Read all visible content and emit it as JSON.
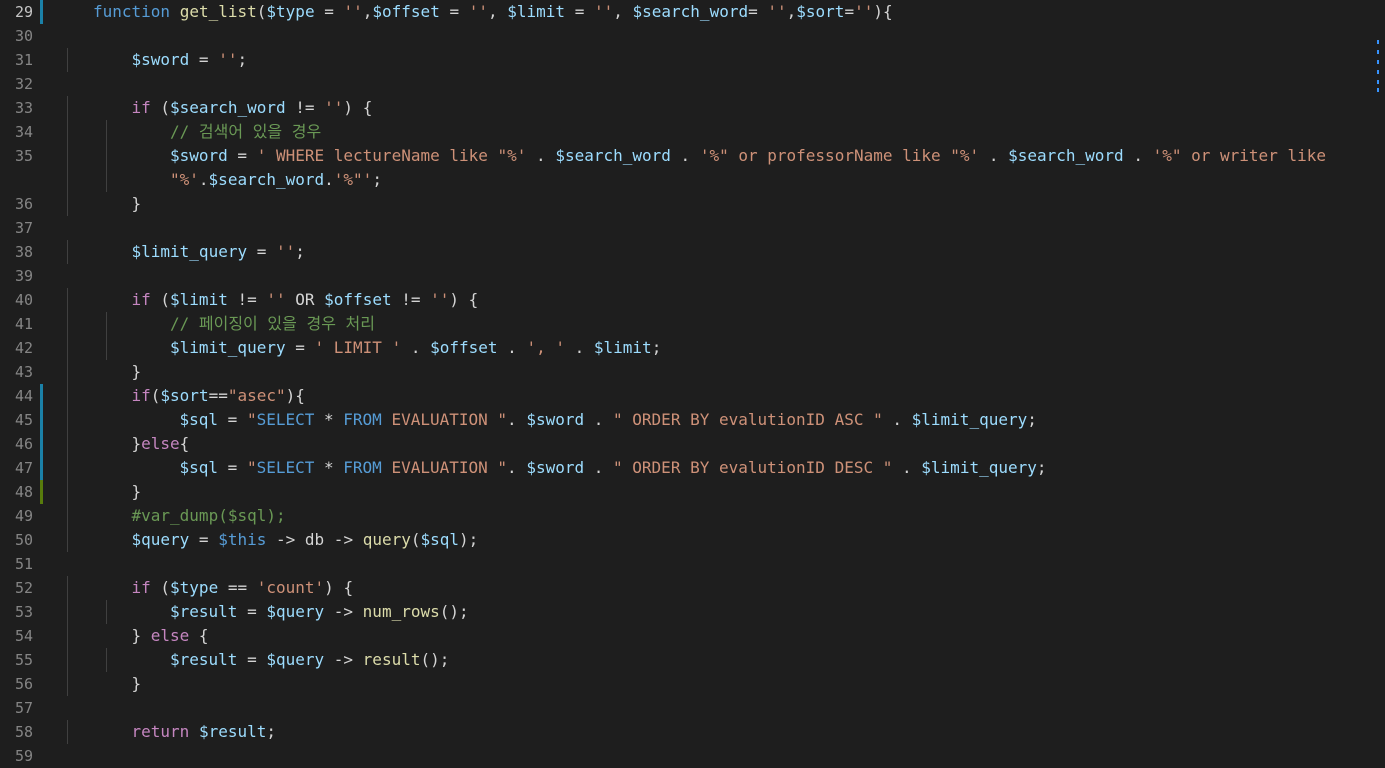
{
  "editor": {
    "lines": [
      {
        "n": "29",
        "mark": "modified",
        "current": true,
        "indent": 1,
        "tokens": [
          {
            "t": "function ",
            "c": "k"
          },
          {
            "t": "get_list",
            "c": "f"
          },
          {
            "t": "(",
            "c": "p"
          },
          {
            "t": "$type",
            "c": "v"
          },
          {
            "t": " = ",
            "c": "p"
          },
          {
            "t": "''",
            "c": "s"
          },
          {
            "t": ",",
            "c": "p"
          },
          {
            "t": "$offset",
            "c": "v"
          },
          {
            "t": " = ",
            "c": "p"
          },
          {
            "t": "''",
            "c": "s"
          },
          {
            "t": ", ",
            "c": "p"
          },
          {
            "t": "$limit",
            "c": "v"
          },
          {
            "t": " = ",
            "c": "p"
          },
          {
            "t": "''",
            "c": "s"
          },
          {
            "t": ", ",
            "c": "p"
          },
          {
            "t": "$search_word",
            "c": "v"
          },
          {
            "t": "= ",
            "c": "p"
          },
          {
            "t": "''",
            "c": "s"
          },
          {
            "t": ",",
            "c": "p"
          },
          {
            "t": "$sort",
            "c": "v"
          },
          {
            "t": "=",
            "c": "p"
          },
          {
            "t": "''",
            "c": "s"
          },
          {
            "t": "){",
            "c": "p"
          }
        ]
      },
      {
        "n": "30",
        "indent": 0,
        "tokens": []
      },
      {
        "n": "31",
        "indent": 2,
        "tokens": [
          {
            "t": "$sword",
            "c": "v"
          },
          {
            "t": " = ",
            "c": "p"
          },
          {
            "t": "''",
            "c": "s"
          },
          {
            "t": ";",
            "c": "p"
          }
        ]
      },
      {
        "n": "32",
        "indent": 0,
        "tokens": []
      },
      {
        "n": "33",
        "indent": 2,
        "tokens": [
          {
            "t": "if",
            "c": "c"
          },
          {
            "t": " (",
            "c": "p"
          },
          {
            "t": "$search_word",
            "c": "v"
          },
          {
            "t": " != ",
            "c": "p"
          },
          {
            "t": "''",
            "c": "s"
          },
          {
            "t": ") {",
            "c": "p"
          }
        ]
      },
      {
        "n": "34",
        "indent": 3,
        "tokens": [
          {
            "t": "// 검색어 있을 경우",
            "c": "cm"
          }
        ]
      },
      {
        "n": "35",
        "indent": 3,
        "tokens": [
          {
            "t": "$sword",
            "c": "v"
          },
          {
            "t": " = ",
            "c": "p"
          },
          {
            "t": "' WHERE lectureName like \"%'",
            "c": "s"
          },
          {
            "t": " . ",
            "c": "p"
          },
          {
            "t": "$search_word",
            "c": "v"
          },
          {
            "t": " . ",
            "c": "p"
          },
          {
            "t": "'%\" or professorName like \"%'",
            "c": "s"
          },
          {
            "t": " . ",
            "c": "p"
          },
          {
            "t": "$search_word",
            "c": "v"
          },
          {
            "t": " . ",
            "c": "p"
          },
          {
            "t": "'%\" or writer like",
            "c": "s"
          }
        ]
      },
      {
        "n": "",
        "indent": 3,
        "tokens": [
          {
            "t": "\"%'",
            "c": "s"
          },
          {
            "t": ".",
            "c": "p"
          },
          {
            "t": "$search_word",
            "c": "v"
          },
          {
            "t": ".",
            "c": "p"
          },
          {
            "t": "'%\"'",
            "c": "s"
          },
          {
            "t": ";",
            "c": "p"
          }
        ]
      },
      {
        "n": "36",
        "indent": 2,
        "tokens": [
          {
            "t": "}",
            "c": "p"
          }
        ]
      },
      {
        "n": "37",
        "indent": 0,
        "tokens": []
      },
      {
        "n": "38",
        "indent": 2,
        "tokens": [
          {
            "t": "$limit_query",
            "c": "v"
          },
          {
            "t": " = ",
            "c": "p"
          },
          {
            "t": "''",
            "c": "s"
          },
          {
            "t": ";",
            "c": "p"
          }
        ]
      },
      {
        "n": "39",
        "indent": 0,
        "tokens": []
      },
      {
        "n": "40",
        "indent": 2,
        "tokens": [
          {
            "t": "if",
            "c": "c"
          },
          {
            "t": " (",
            "c": "p"
          },
          {
            "t": "$limit",
            "c": "v"
          },
          {
            "t": " != ",
            "c": "p"
          },
          {
            "t": "''",
            "c": "s"
          },
          {
            "t": " OR ",
            "c": "p"
          },
          {
            "t": "$offset",
            "c": "v"
          },
          {
            "t": " != ",
            "c": "p"
          },
          {
            "t": "''",
            "c": "s"
          },
          {
            "t": ") {",
            "c": "p"
          }
        ]
      },
      {
        "n": "41",
        "indent": 3,
        "tokens": [
          {
            "t": "// 페이징이 있을 경우 처리",
            "c": "cm"
          }
        ]
      },
      {
        "n": "42",
        "indent": 3,
        "tokens": [
          {
            "t": "$limit_query",
            "c": "v"
          },
          {
            "t": " = ",
            "c": "p"
          },
          {
            "t": "' LIMIT '",
            "c": "s"
          },
          {
            "t": " . ",
            "c": "p"
          },
          {
            "t": "$offset",
            "c": "v"
          },
          {
            "t": " . ",
            "c": "p"
          },
          {
            "t": "', '",
            "c": "s"
          },
          {
            "t": " . ",
            "c": "p"
          },
          {
            "t": "$limit",
            "c": "v"
          },
          {
            "t": ";",
            "c": "p"
          }
        ]
      },
      {
        "n": "43",
        "indent": 2,
        "tokens": [
          {
            "t": "}",
            "c": "p"
          }
        ]
      },
      {
        "n": "44",
        "mark": "modified",
        "indent": 2,
        "tokens": [
          {
            "t": "if",
            "c": "c"
          },
          {
            "t": "(",
            "c": "p"
          },
          {
            "t": "$sort",
            "c": "v"
          },
          {
            "t": "==",
            "c": "p"
          },
          {
            "t": "\"asec\"",
            "c": "s"
          },
          {
            "t": "){",
            "c": "p"
          }
        ]
      },
      {
        "n": "45",
        "mark": "modified",
        "indent": 2,
        "extra": 1,
        "tokens": [
          {
            "t": "$sql",
            "c": "v"
          },
          {
            "t": " = ",
            "c": "p"
          },
          {
            "t": "\"",
            "c": "s"
          },
          {
            "t": "SELECT",
            "c": "k"
          },
          {
            "t": " * ",
            "c": "p"
          },
          {
            "t": "FROM",
            "c": "k"
          },
          {
            "t": " EVALUATION \"",
            "c": "s"
          },
          {
            "t": ". ",
            "c": "p"
          },
          {
            "t": "$sword",
            "c": "v"
          },
          {
            "t": " . ",
            "c": "p"
          },
          {
            "t": "\" ORDER BY evalutionID ASC \"",
            "c": "s"
          },
          {
            "t": " . ",
            "c": "p"
          },
          {
            "t": "$limit_query",
            "c": "v"
          },
          {
            "t": ";",
            "c": "p"
          }
        ]
      },
      {
        "n": "46",
        "mark": "modified",
        "indent": 2,
        "tokens": [
          {
            "t": "}",
            "c": "p"
          },
          {
            "t": "else",
            "c": "c"
          },
          {
            "t": "{",
            "c": "p"
          }
        ]
      },
      {
        "n": "47",
        "mark": "modified",
        "indent": 2,
        "extra": 1,
        "tokens": [
          {
            "t": "$sql",
            "c": "v"
          },
          {
            "t": " = ",
            "c": "p"
          },
          {
            "t": "\"",
            "c": "s"
          },
          {
            "t": "SELECT",
            "c": "k"
          },
          {
            "t": " * ",
            "c": "p"
          },
          {
            "t": "FROM",
            "c": "k"
          },
          {
            "t": " EVALUATION \"",
            "c": "s"
          },
          {
            "t": ". ",
            "c": "p"
          },
          {
            "t": "$sword",
            "c": "v"
          },
          {
            "t": " . ",
            "c": "p"
          },
          {
            "t": "\" ORDER BY evalutionID DESC \"",
            "c": "s"
          },
          {
            "t": " . ",
            "c": "p"
          },
          {
            "t": "$limit_query",
            "c": "v"
          },
          {
            "t": ";",
            "c": "p"
          }
        ]
      },
      {
        "n": "48",
        "mark": "added",
        "indent": 2,
        "tokens": [
          {
            "t": "}",
            "c": "p"
          }
        ]
      },
      {
        "n": "49",
        "indent": 2,
        "tokens": [
          {
            "t": "#var_dump($sql);",
            "c": "cm"
          }
        ]
      },
      {
        "n": "50",
        "indent": 2,
        "tokens": [
          {
            "t": "$query",
            "c": "v"
          },
          {
            "t": " = ",
            "c": "p"
          },
          {
            "t": "$this",
            "c": "k"
          },
          {
            "t": " -> ",
            "c": "p"
          },
          {
            "t": "db",
            "c": "p"
          },
          {
            "t": " -> ",
            "c": "p"
          },
          {
            "t": "query",
            "c": "f"
          },
          {
            "t": "(",
            "c": "p"
          },
          {
            "t": "$sql",
            "c": "v"
          },
          {
            "t": ");",
            "c": "p"
          }
        ]
      },
      {
        "n": "51",
        "indent": 0,
        "tokens": []
      },
      {
        "n": "52",
        "indent": 2,
        "tokens": [
          {
            "t": "if",
            "c": "c"
          },
          {
            "t": " (",
            "c": "p"
          },
          {
            "t": "$type",
            "c": "v"
          },
          {
            "t": " == ",
            "c": "p"
          },
          {
            "t": "'count'",
            "c": "s"
          },
          {
            "t": ") {",
            "c": "p"
          }
        ]
      },
      {
        "n": "53",
        "indent": 3,
        "tokens": [
          {
            "t": "$result",
            "c": "v"
          },
          {
            "t": " = ",
            "c": "p"
          },
          {
            "t": "$query",
            "c": "v"
          },
          {
            "t": " -> ",
            "c": "p"
          },
          {
            "t": "num_rows",
            "c": "f"
          },
          {
            "t": "();",
            "c": "p"
          }
        ]
      },
      {
        "n": "54",
        "indent": 2,
        "tokens": [
          {
            "t": "} ",
            "c": "p"
          },
          {
            "t": "else",
            "c": "c"
          },
          {
            "t": " {",
            "c": "p"
          }
        ]
      },
      {
        "n": "55",
        "indent": 3,
        "tokens": [
          {
            "t": "$result",
            "c": "v"
          },
          {
            "t": " = ",
            "c": "p"
          },
          {
            "t": "$query",
            "c": "v"
          },
          {
            "t": " -> ",
            "c": "p"
          },
          {
            "t": "result",
            "c": "f"
          },
          {
            "t": "();",
            "c": "p"
          }
        ]
      },
      {
        "n": "56",
        "indent": 2,
        "tokens": [
          {
            "t": "}",
            "c": "p"
          }
        ]
      },
      {
        "n": "57",
        "indent": 0,
        "tokens": []
      },
      {
        "n": "58",
        "indent": 2,
        "tokens": [
          {
            "t": "return",
            "c": "c"
          },
          {
            "t": " ",
            "c": "p"
          },
          {
            "t": "$result",
            "c": "v"
          },
          {
            "t": ";",
            "c": "p"
          }
        ]
      },
      {
        "n": "59",
        "indent": 0,
        "tokens": []
      }
    ]
  },
  "colors": {
    "background": "#1e1e1e",
    "gutter_modified": "#1b81a8",
    "gutter_added": "#587c0c"
  }
}
